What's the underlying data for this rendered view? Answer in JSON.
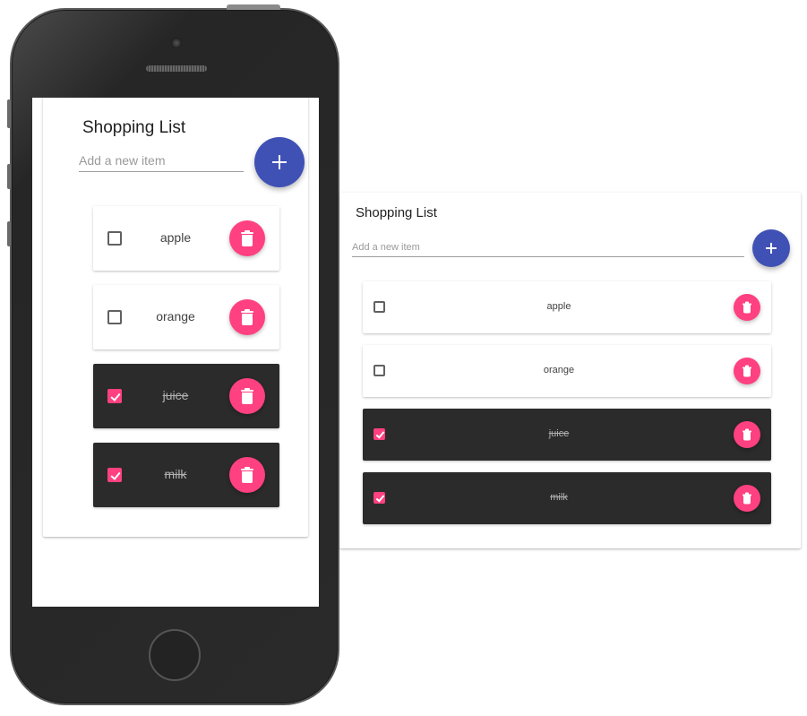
{
  "mobile": {
    "title": "Shopping List",
    "new_item_placeholder": "Add a new item",
    "new_item_value": "",
    "items": [
      {
        "label": "apple",
        "checked": false
      },
      {
        "label": "orange",
        "checked": false
      },
      {
        "label": "juice",
        "checked": true
      },
      {
        "label": "milk",
        "checked": true
      }
    ]
  },
  "desktop": {
    "title": "Shopping List",
    "new_item_placeholder": "Add a new item",
    "new_item_value": "",
    "items": [
      {
        "label": "apple",
        "checked": false
      },
      {
        "label": "orange",
        "checked": false
      },
      {
        "label": "juice",
        "checked": true
      },
      {
        "label": "milk",
        "checked": true
      }
    ]
  },
  "colors": {
    "accent": "#ff4081",
    "primary": "#3f51b5",
    "done_item_background": "#2b2b2b"
  },
  "icons": {
    "add": "plus-icon",
    "delete": "trash-icon",
    "checked": "check-icon"
  }
}
